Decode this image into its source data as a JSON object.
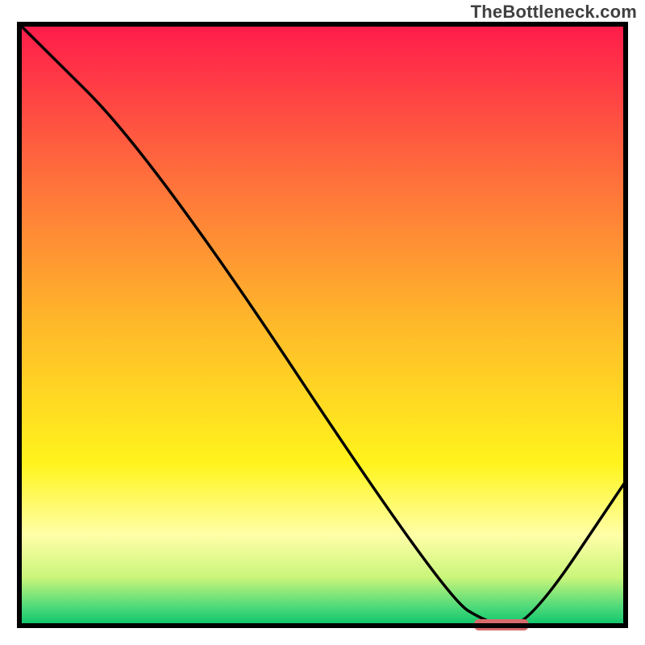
{
  "attribution": "TheBottleneck.com",
  "chart_data": {
    "type": "line",
    "title": "",
    "xlabel": "",
    "ylabel": "",
    "xlim": [
      0,
      100
    ],
    "ylim": [
      0,
      100
    ],
    "series": [
      {
        "name": "curve",
        "x": [
          0,
          22,
          70,
          78,
          84,
          100
        ],
        "y": [
          100,
          78,
          5,
          0,
          0,
          24
        ]
      }
    ],
    "marker": {
      "x_start": 75,
      "x_end": 84,
      "y": 0
    },
    "gradient_stops": [
      {
        "offset": 0.0,
        "color": "#ff1b4b"
      },
      {
        "offset": 0.25,
        "color": "#ff6e3c"
      },
      {
        "offset": 0.5,
        "color": "#ffb92a"
      },
      {
        "offset": 0.73,
        "color": "#fff41c"
      },
      {
        "offset": 0.85,
        "color": "#ffffa8"
      },
      {
        "offset": 0.92,
        "color": "#c9f57a"
      },
      {
        "offset": 0.97,
        "color": "#4bd97a"
      },
      {
        "offset": 1.0,
        "color": "#0ac46a"
      }
    ],
    "marker_color": "#d86a6c",
    "curve_color": "#000000",
    "frame_color": "#000000"
  }
}
